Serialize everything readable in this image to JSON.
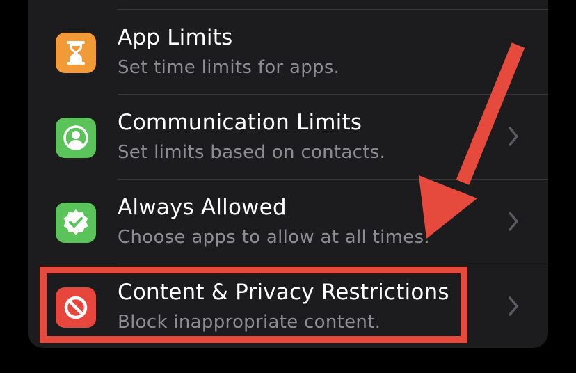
{
  "settings": {
    "items": [
      {
        "title": "App Limits",
        "subtitle": "Set time limits for apps.",
        "icon": "hourglass-icon",
        "icon_color": "#f19a37"
      },
      {
        "title": "Communication Limits",
        "subtitle": "Set limits based on contacts.",
        "icon": "person-circle-icon",
        "icon_color": "#5ac35a"
      },
      {
        "title": "Always Allowed",
        "subtitle": "Choose apps to allow at all times.",
        "icon": "checkmark-badge-icon",
        "icon_color": "#5ac35a"
      },
      {
        "title": "Content & Privacy Restrictions",
        "subtitle": "Block inappropriate content.",
        "icon": "no-entry-icon",
        "icon_color": "#e6463c"
      }
    ]
  },
  "annotation": {
    "color": "#e64a3c",
    "highlighted_item": "Content & Privacy Restrictions"
  },
  "theme": {
    "background": "#000000",
    "card": "#1c1c1e",
    "separator": "#38383a",
    "title_color": "#ffffff",
    "subtitle_color": "#8d8d93",
    "chevron_color": "#5a5a5f"
  }
}
